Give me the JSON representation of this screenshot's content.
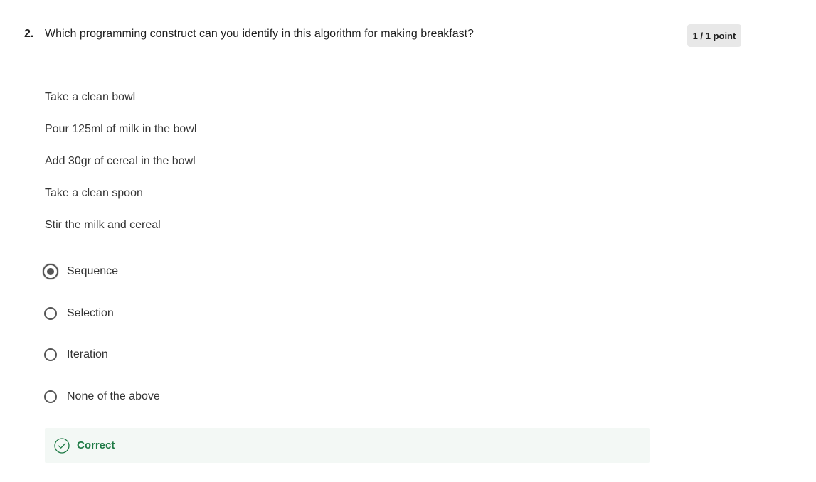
{
  "question": {
    "number": "2.",
    "text": "Which programming construct can you identify in this algorithm for making breakfast?",
    "score": "1 / 1 point"
  },
  "steps": [
    "Take a clean bowl",
    "Pour 125ml of milk in the bowl",
    "Add 30gr of cereal in the bowl",
    "Take a clean spoon",
    "Stir the milk and cereal"
  ],
  "options": [
    {
      "label": "Sequence",
      "selected": true
    },
    {
      "label": "Selection",
      "selected": false
    },
    {
      "label": "Iteration",
      "selected": false
    },
    {
      "label": "None of the above",
      "selected": false
    }
  ],
  "feedback": {
    "label": "Correct",
    "icon": "check-circle-icon",
    "color": "#1e7a45",
    "background": "#f3f8f5"
  }
}
